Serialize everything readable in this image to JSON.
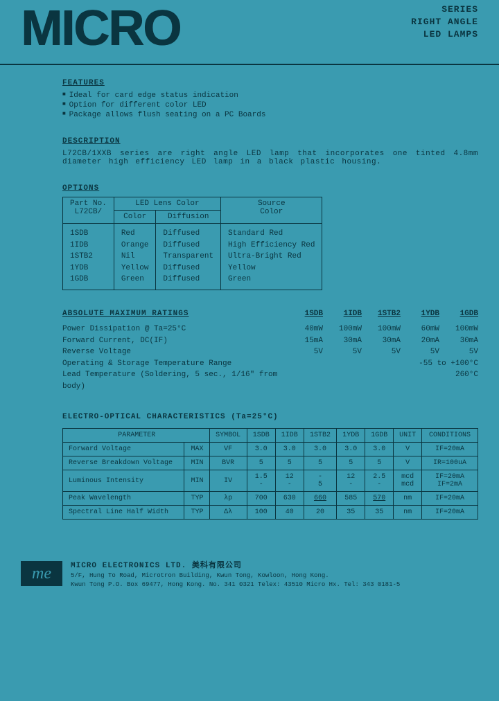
{
  "header": {
    "logo": "MICRO",
    "series": "SERIES",
    "product": "RIGHT ANGLE\nLED LAMPS"
  },
  "features": {
    "title": "FEATURES",
    "items": [
      "Ideal for card edge status indication",
      "Option for different color LED",
      "Package allows flush seating on a PC Boards"
    ]
  },
  "description": {
    "title": "DESCRIPTION",
    "text": "L72CB/1XXB series are right angle LED lamp that incorporates one tinted 4.8mm diameter high efficiency LED lamp in a black plastic housing."
  },
  "options": {
    "title": "OPTIONS",
    "headers": {
      "part": "Part No.\nL72CB/",
      "lens": "LED Lens Color",
      "color": "Color",
      "diffusion": "Diffusion",
      "source": "Source\nColor"
    },
    "rows": [
      {
        "part": "1SDB",
        "color": "Red",
        "diffusion": "Diffused",
        "source": "Standard Red"
      },
      {
        "part": "1IDB",
        "color": "Orange",
        "diffusion": "Diffused",
        "source": "High Efficiency Red"
      },
      {
        "part": "1STB2",
        "color": "Nil",
        "diffusion": "Transparent",
        "source": "Ultra-Bright Red"
      },
      {
        "part": "1YDB",
        "color": "Yellow",
        "diffusion": "Diffused",
        "source": "Yellow"
      },
      {
        "part": "1GDB",
        "color": "Green",
        "diffusion": "Diffused",
        "source": "Green"
      }
    ]
  },
  "ratings": {
    "title": "ABSOLUTE MAXIMUM RATINGS",
    "cols": [
      "1SDB",
      "1IDB",
      "1STB2",
      "1YDB",
      "1GDB"
    ],
    "rows": [
      {
        "label": "Power Dissipation @ Ta=25°C",
        "vals": [
          "40mW",
          "100mW",
          "100mW",
          "60mW",
          "100mW"
        ]
      },
      {
        "label": "Forward Current, DC(IF)",
        "vals": [
          "15mA",
          "30mA",
          "30mA",
          "20mA",
          "30mA"
        ]
      },
      {
        "label": "Reverse Voltage",
        "vals": [
          "5V",
          "5V",
          "5V",
          "5V",
          "5V"
        ]
      }
    ],
    "temp_op": {
      "label": "Operating & Storage Temperature Range",
      "val": "-55 to +100°C"
    },
    "temp_lead": {
      "label": "Lead Temperature (Soldering, 5 sec., 1/16\" from body)",
      "val": "260°C"
    }
  },
  "eo": {
    "title": "ELECTRO-OPTICAL CHARACTERISTICS (Ta=25°C)",
    "headers": {
      "param": "PARAMETER",
      "symbol": "SYMBOL",
      "unit": "UNIT",
      "cond": "CONDITIONS"
    },
    "cols": [
      "1SDB",
      "1IDB",
      "1STB2",
      "1YDB",
      "1GDB"
    ],
    "rows": [
      {
        "param": "Forward Voltage",
        "lim": "MAX",
        "sym": "VF",
        "v": [
          "3.0",
          "3.0",
          "3.0",
          "3.0",
          "3.0"
        ],
        "unit": "V",
        "cond": "IF=20mA"
      },
      {
        "param": "Reverse Breakdown Voltage",
        "lim": "MIN",
        "sym": "BVR",
        "v": [
          "5",
          "5",
          "5",
          "5",
          "5"
        ],
        "unit": "V",
        "cond": "IR=100uA"
      },
      {
        "param": "Luminous Intensity",
        "lim": "MIN",
        "sym": "IV",
        "v": [
          "1.5\n-",
          "12\n-",
          "-\n5",
          "12\n-",
          "2.5\n-"
        ],
        "unit": "mcd\nmcd",
        "cond": "IF=20mA\nIF=2mA"
      },
      {
        "param": "Peak Wavelength",
        "lim": "TYP",
        "sym": "λp",
        "v": [
          "700",
          "630",
          "660",
          "585",
          "570"
        ],
        "unit": "nm",
        "cond": "IF=20mA"
      },
      {
        "param": "Spectral Line Half Width",
        "lim": "TYP",
        "sym": "Δλ",
        "v": [
          "100",
          "40",
          "20",
          "35",
          "35"
        ],
        "unit": "nm",
        "cond": "IF=20mA"
      }
    ]
  },
  "footer": {
    "logo": "me",
    "company": "MICRO ELECTRONICS LTD.  美科有限公司",
    "addr1": "5/F, Hung To Road, Microtron Building, Kwun Tong, Kowloon, Hong Kong.",
    "addr2": "Kwun Tong P.O. Box 69477, Hong Kong. No. 341 0321   Telex: 43510 Micro Hx.   Tel: 343 0181-5"
  }
}
